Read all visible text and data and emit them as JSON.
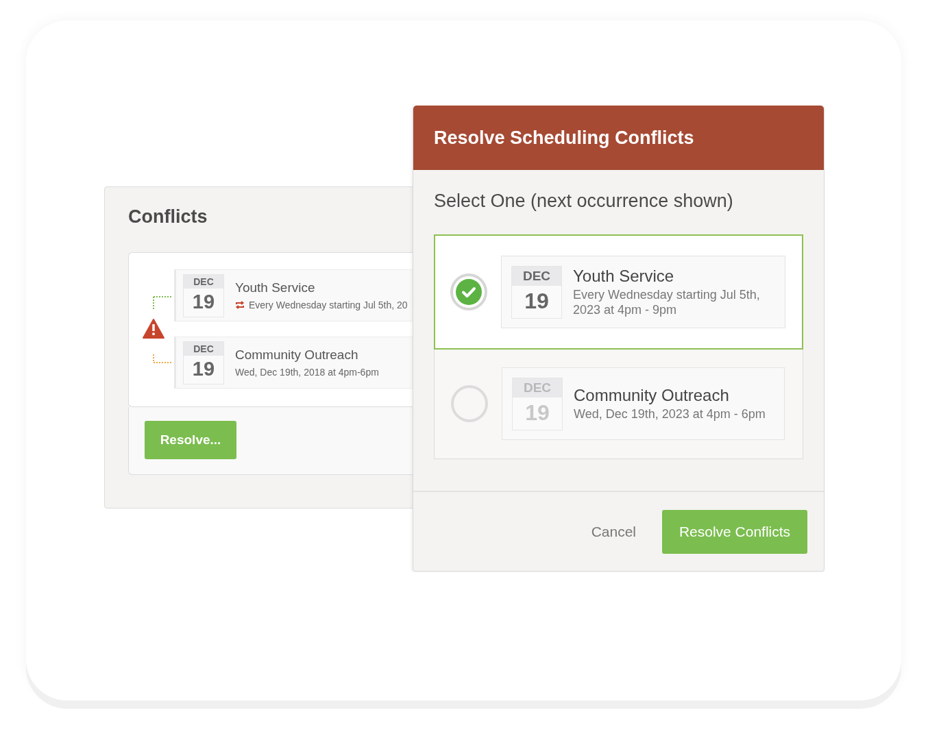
{
  "conflicts_panel": {
    "title": "Conflicts",
    "events": [
      {
        "month": "DEC",
        "day": "19",
        "title": "Youth Service",
        "detail": "Every Wednesday starting Jul 5th, 20",
        "recurring": true
      },
      {
        "month": "DEC",
        "day": "19",
        "title": "Community Outreach",
        "detail": "Wed, Dec 19th, 2018 at 4pm-6pm",
        "recurring": false
      }
    ],
    "resolve_button": "Resolve..."
  },
  "dialog": {
    "title": "Resolve Scheduling Conflicts",
    "prompt": "Select One (next occurrence shown)",
    "options": [
      {
        "month": "DEC",
        "day": "19",
        "title": "Youth Service",
        "detail": "Every Wednesday starting Jul 5th, 2023 at 4pm - 9pm",
        "selected": true
      },
      {
        "month": "DEC",
        "day": "19",
        "title": "Community Outreach",
        "detail": "Wed, Dec 19th, 2023 at 4pm - 6pm",
        "selected": false
      }
    ],
    "cancel_button": "Cancel",
    "confirm_button": "Resolve Conflicts"
  }
}
